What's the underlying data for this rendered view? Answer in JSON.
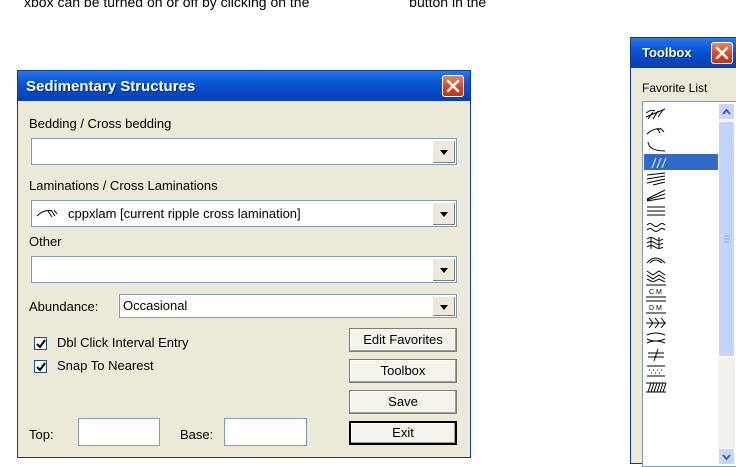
{
  "background_text": {
    "left": "xbox can be turned on or off by clicking on the",
    "right": "button in the"
  },
  "sedimentary_dialog": {
    "title": "Sedimentary Structures",
    "bedding_label": "Bedding / Cross bedding",
    "bedding_value": "",
    "laminations_label": "Laminations / Cross Laminations",
    "laminations_value": "cppxlam [current ripple cross lamination]",
    "other_label": "Other",
    "other_value": "",
    "abundance_label": "Abundance:",
    "abundance_value": "Occasional",
    "dbl_click_label": "Dbl Click Interval Entry",
    "dbl_click_checked": true,
    "snap_label": "Snap To Nearest",
    "snap_checked": true,
    "edit_favorites_label": "Edit Favorites",
    "toolbox_label": "Toolbox",
    "save_label": "Save",
    "exit_label": "Exit",
    "top_label": "Top:",
    "top_value": "",
    "base_label": "Base:",
    "base_value": ""
  },
  "toolbox_window": {
    "title": "Toolbox",
    "favorite_list_label": "Favorite List",
    "items": [
      {
        "icon": "ripple-cross-bedding-icon"
      },
      {
        "icon": "current-ripple-lamination-icon"
      },
      {
        "icon": "concave-curve-icon"
      },
      {
        "icon": "slanted-lines-icon",
        "selected": true,
        "label": "///"
      },
      {
        "icon": "convergent-lamination-icon"
      },
      {
        "icon": "wedge-lamination-icon"
      },
      {
        "icon": "parallel-lamination-icon"
      },
      {
        "icon": "wavy-lamination-icon"
      },
      {
        "icon": "convolute-bedding-icon"
      },
      {
        "icon": "arch-icon"
      },
      {
        "icon": "chevron-lamination-icon"
      },
      {
        "icon": "cm-scale-icon",
        "label": "C M"
      },
      {
        "icon": "dm-scale-icon",
        "label": "D M"
      },
      {
        "icon": "herringbone-icon"
      },
      {
        "icon": "lenticular-bedding-icon"
      },
      {
        "icon": "not-equal-icon"
      },
      {
        "icon": "dotted-box-icon"
      },
      {
        "icon": "hatched-bed-icon"
      }
    ]
  },
  "colors": {
    "title_bar": "#0a5ad8",
    "dialog_face": "#ece9d8",
    "close_button": "#d6411f",
    "selection": "#316ac5"
  }
}
